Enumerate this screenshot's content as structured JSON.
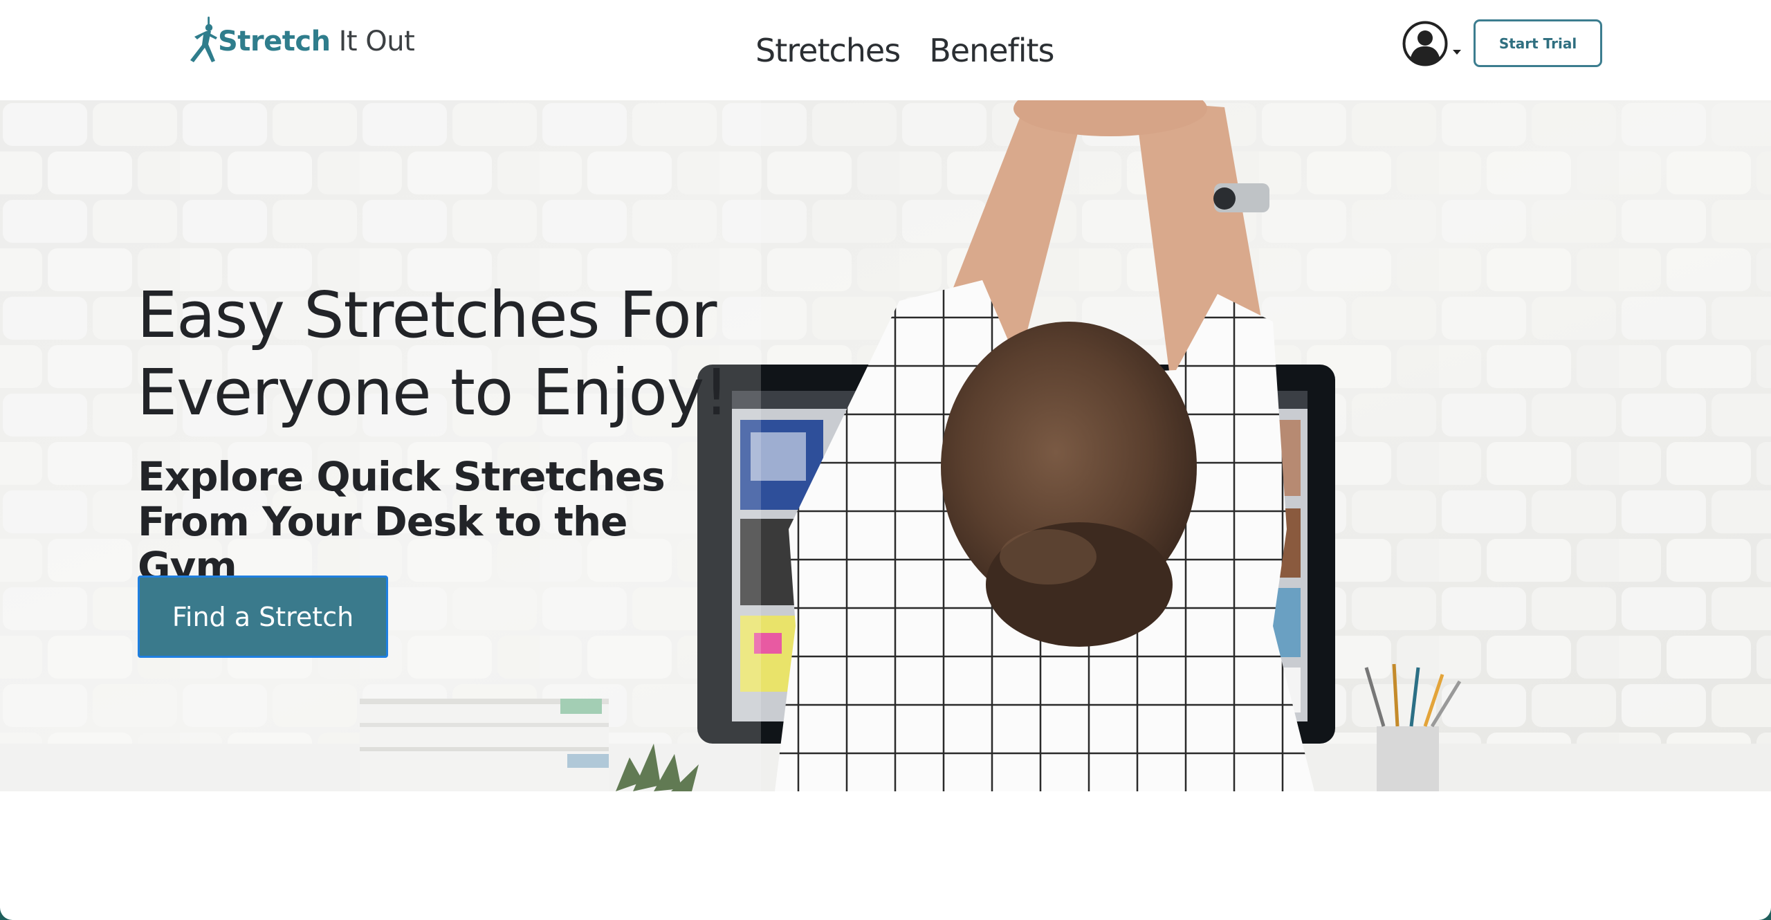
{
  "brand": {
    "name_bold": "Stretch",
    "name_light": "It Out",
    "logo_icon": "stretching-person-icon",
    "brand_color": "#2f7d8c"
  },
  "nav": {
    "links": [
      {
        "label": "Stretches"
      },
      {
        "label": "Benefits"
      }
    ]
  },
  "header_actions": {
    "account_icon": "user-avatar-icon",
    "trial_button": "Start Trial"
  },
  "hero": {
    "title": "Easy Stretches For Everyone to Enjoy!",
    "subtitle_lines": [
      "Explore Quick Stretches",
      "From Your Desk to the Gym"
    ],
    "cta_label": "Find a Stretch",
    "cta_color": "#3a7a8c",
    "background_image": "woman-stretching-at-desk-photo"
  }
}
